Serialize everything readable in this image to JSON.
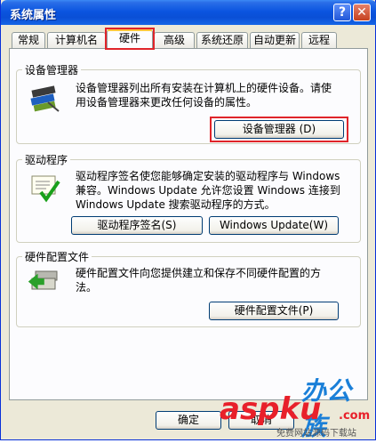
{
  "window": {
    "title": "系统属性",
    "help_icon": "?",
    "close_icon": "✕"
  },
  "tabs": [
    {
      "label": "常规"
    },
    {
      "label": "计算机名"
    },
    {
      "label": "硬件"
    },
    {
      "label": "高级"
    },
    {
      "label": "系统还原"
    },
    {
      "label": "自动更新"
    },
    {
      "label": "远程"
    }
  ],
  "device_manager": {
    "title": "设备管理器",
    "description_line1": "设备管理器列出所有安装在计算机上的硬件设备。请使",
    "description_line2": "用设备管理器来更改任何设备的属性。",
    "button_label": "设备管理器 (D)"
  },
  "drivers": {
    "title": "驱动程序",
    "description_line1": "驱动程序签名使您能够确定安装的驱动程序与 Windows",
    "description_line2": "兼容。Windows Update 允许您设置 Windows 连接到",
    "description_line3": "Windows Update 搜索驱动程序的方式。",
    "signing_button_label": "驱动程序签名(S)",
    "update_button_label": "Windows Update(W)"
  },
  "hardware_profiles": {
    "title": "硬件配置文件",
    "description_line1": "硬件配置文件向您提供建立和保存不同硬件配置的方",
    "description_line2": "法。",
    "button_label": "硬件配置文件(P)"
  },
  "footer": {
    "ok_label": "确定",
    "cancel_label": "取消"
  },
  "watermark": {
    "brand_cn": "办公族",
    "brand_en": "aspku",
    "domain_suffix": ".com",
    "tagline": "免费网站源码下载站"
  },
  "colors": {
    "titlebar": "#0a4fd6",
    "highlight_box": "#e0242a",
    "window_bg": "#ece9d8"
  }
}
